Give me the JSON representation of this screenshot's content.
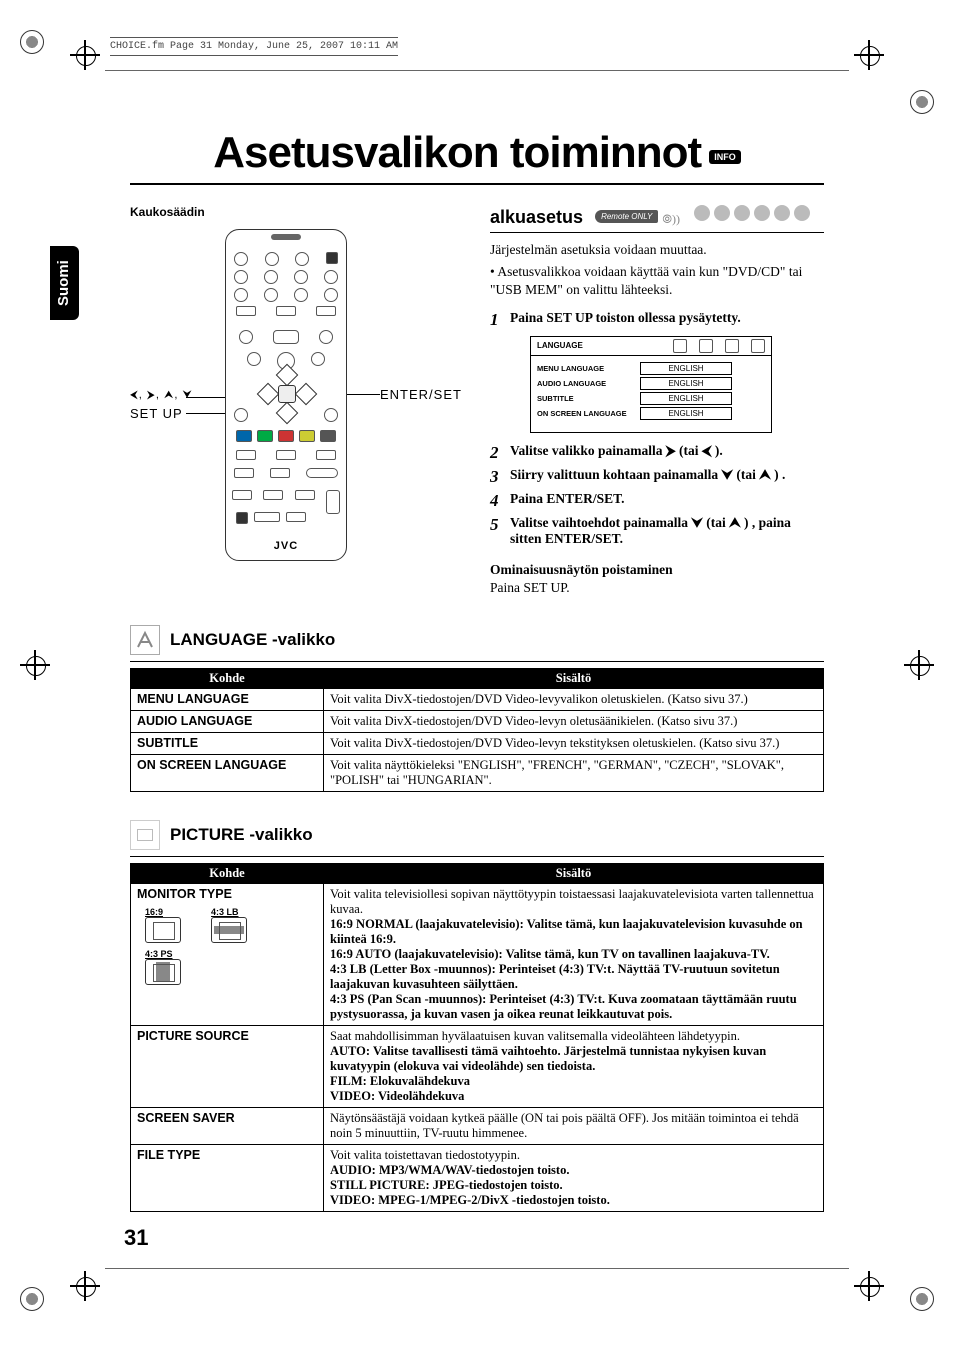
{
  "header_line": "CHOICE.fm  Page 31  Monday, June 25, 2007  10:11 AM",
  "side_tab": "Suomi",
  "main_title": "Asetusvalikon toiminnot",
  "info_badge": "INFO",
  "remote_section_label": "Kaukosäädin",
  "remote_arrow_dirs": "⮜, ⮞, ⮝, ⮟",
  "remote_setup_label": "SET UP",
  "remote_enter_label": "ENTER/SET",
  "remote_logo": "JVC",
  "right": {
    "heading": "alkuasetus",
    "remote_only": "Remote ONLY",
    "intro": "Järjestelmän asetuksia voidaan muuttaa.",
    "bullet": "Asetusvalikkoa voidaan käyttää vain kun \"DVD/CD\" tai \"USB MEM\" on valittu lähteeksi.",
    "steps": [
      "Paina SET UP toiston ollessa pysäytetty.",
      "Valitse valikko painamalla ⮞ (tai ⮜ ).",
      "Siirry valittuun kohtaan painamalla ⮟ (tai ⮝ ) .",
      "Paina ENTER/SET.",
      "Valitse vaihtoehdot painamalla ⮟ (tai ⮝ ) , paina sitten ENTER/SET."
    ],
    "setup_menu": {
      "tab_label": "LANGUAGE",
      "rows": [
        {
          "k": "MENU LANGUAGE",
          "v": "ENGLISH"
        },
        {
          "k": "AUDIO LANGUAGE",
          "v": "ENGLISH"
        },
        {
          "k": "SUBTITLE",
          "v": "ENGLISH"
        },
        {
          "k": "ON SCREEN LANGUAGE",
          "v": "ENGLISH"
        }
      ]
    },
    "dismiss_head": "Ominaisuusnäytön poistaminen",
    "dismiss_body": "Paina SET UP."
  },
  "tables": {
    "col_item": "Kohde",
    "col_content": "Sisältö",
    "language": {
      "heading": "LANGUAGE -valikko",
      "rows": [
        {
          "k": "MENU LANGUAGE",
          "v": "Voit valita DivX-tiedostojen/DVD Video-levyvalikon oletuskielen. (Katso sivu 37.)"
        },
        {
          "k": "AUDIO LANGUAGE",
          "v": "Voit valita DivX-tiedostojen/DVD Video-levyn oletusäänikielen. (Katso sivu 37.)"
        },
        {
          "k": "SUBTITLE",
          "v": "Voit valita DivX-tiedostojen/DVD Video-levyn tekstityksen oletuskielen. (Katso sivu 37.)"
        },
        {
          "k": "ON SCREEN LANGUAGE",
          "v": "Voit valita näyttökieleksi \"ENGLISH\", \"FRENCH\", \"GERMAN\", \"CZECH\", \"SLOVAK\", \"POLISH\" tai \"HUNGARIAN\"."
        }
      ]
    },
    "picture": {
      "heading": "PICTURE -valikko",
      "monitor_labels": {
        "a": "16:9",
        "b": "4:3 LB",
        "c": "4:3 PS"
      },
      "rows": [
        {
          "k": "MONITOR TYPE",
          "v_lines": [
            "Voit valita televisiollesi sopivan näyttötyypin toistaessasi laajakuvatelevisiota varten tallennettua kuvaa.",
            "16:9 NORMAL (laajakuvatelevisio): Valitse tämä, kun laajakuvatelevision kuvasuhde on kiinteä 16:9.",
            "16:9 AUTO (laajakuvatelevisio): Valitse tämä, kun TV on tavallinen laajakuva-TV.",
            "4:3 LB (Letter Box -muunnos): Perinteiset (4:3) TV:t. Näyttää TV-ruutuun sovitetun laajakuvan kuvasuhteen säilyttäen.",
            "4:3 PS (Pan Scan -muunnos): Perinteiset (4:3) TV:t. Kuva zoomataan täyttämään ruutu pystysuorassa, ja kuvan vasen ja oikea reunat leikkautuvat pois."
          ]
        },
        {
          "k": "PICTURE SOURCE",
          "v_lines": [
            "Saat mahdollisimman hyvälaatuisen kuvan valitsemalla videolähteen lähdetyypin.",
            "AUTO: Valitse tavallisesti tämä vaihtoehto. Järjestelmä tunnistaa nykyisen kuvan kuvatyypin (elokuva vai videolähde) sen tiedoista.",
            "FILM: Elokuvalähdekuva",
            "VIDEO: Videolähdekuva"
          ]
        },
        {
          "k": "SCREEN SAVER",
          "v_lines": [
            "Näytönsäästäjä voidaan kytkeä päälle (ON tai pois päältä OFF). Jos mitään toimintoa ei tehdä noin 5 minuuttiin, TV-ruutu himmenee."
          ]
        },
        {
          "k": "FILE TYPE",
          "v_lines": [
            "Voit valita toistettavan tiedostotyypin.",
            "AUDIO: MP3/WMA/WAV-tiedostojen toisto.",
            "STILL PICTURE: JPEG-tiedostojen toisto.",
            "VIDEO: MPEG-1/MPEG-2/DivX -tiedostojen toisto."
          ]
        }
      ]
    }
  },
  "page_number": "31"
}
